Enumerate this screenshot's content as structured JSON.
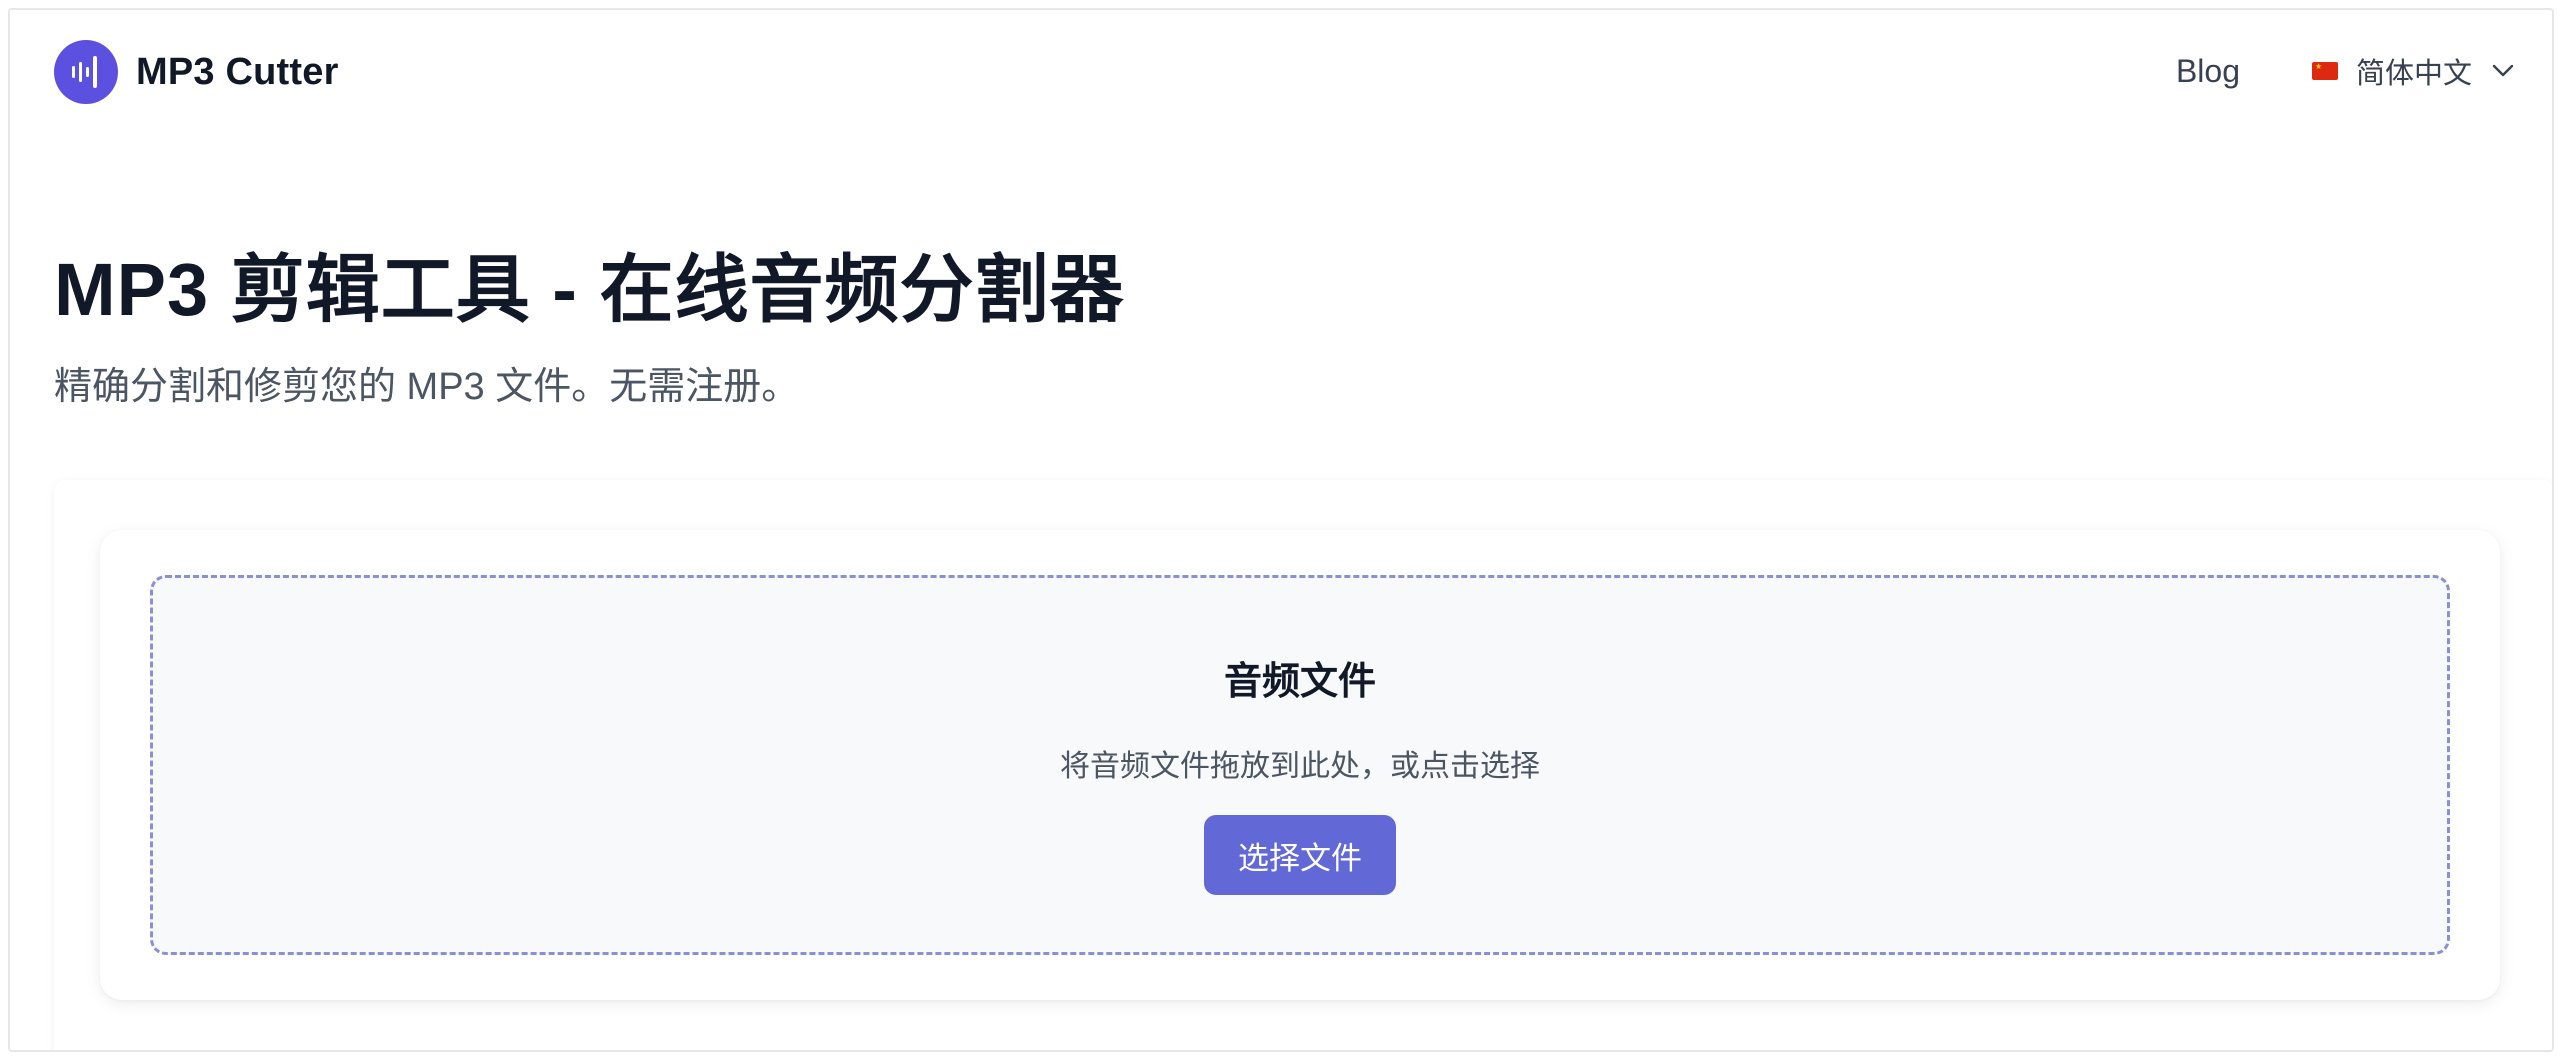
{
  "header": {
    "brand_name": "MP3 Cutter",
    "nav": {
      "blog_label": "Blog",
      "language_label": "简体中文"
    }
  },
  "hero": {
    "title": "MP3 剪辑工具 - 在线音频分割器",
    "subtitle": "精确分割和修剪您的 MP3 文件。无需注册。"
  },
  "dropzone": {
    "title": "音频文件",
    "hint": "将音频文件拖放到此处，或点击选择",
    "button_label": "选择文件"
  },
  "icons": {
    "logo": "waveform-icon",
    "language_flag": "china-flag-icon",
    "language_dropdown": "chevron-down-icon"
  },
  "colors": {
    "accent": "#5b50e0",
    "button": "#6268d6",
    "dropzone_border": "#8b90d4"
  }
}
